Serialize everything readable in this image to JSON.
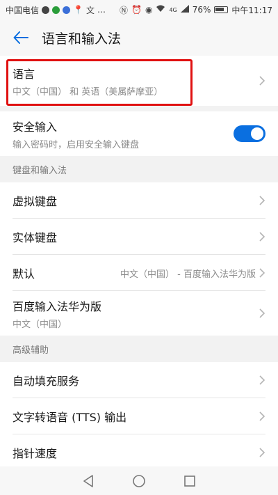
{
  "status_bar": {
    "carrier": "中国电信",
    "dots": "…",
    "network": "4G",
    "battery": "76%",
    "time": "中午11:17"
  },
  "header": {
    "title": "语言和输入法"
  },
  "language": {
    "title": "语言",
    "subtitle": "中文（中国） 和 英语（美属萨摩亚）"
  },
  "secure_input": {
    "title": "安全输入",
    "subtitle": "输入密码时，启用安全输入键盘",
    "enabled": true
  },
  "sections": {
    "keyboard_header": "键盘和输入法",
    "advanced_header": "高级辅助"
  },
  "keyboard_items": {
    "virtual": "虚拟键盘",
    "physical": "实体键盘",
    "default_label": "默认",
    "default_value": "中文（中国） - 百度输入法华为版",
    "baidu_title": "百度输入法华为版",
    "baidu_subtitle": "中文（中国）"
  },
  "advanced_items": {
    "autofill": "自动填充服务",
    "tts": "文字转语音 (TTS) 输出",
    "pointer_speed": "指针速度"
  },
  "colors": {
    "accent": "#0a6fe0",
    "highlight": "#e01010"
  }
}
